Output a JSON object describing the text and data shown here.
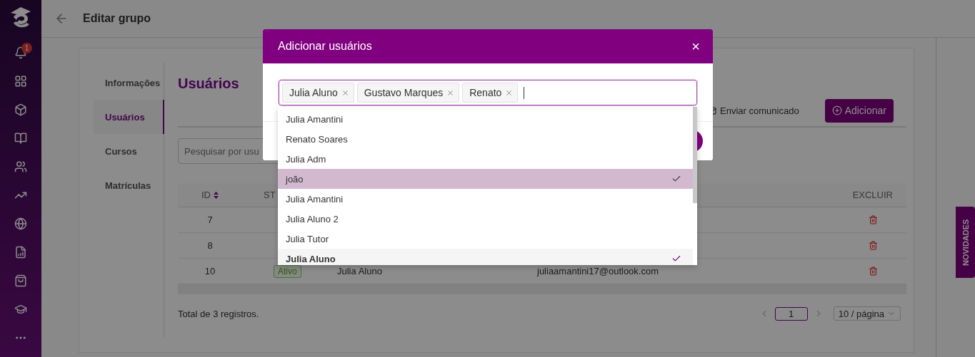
{
  "sidebar": {
    "notifications": "1",
    "items": [
      {
        "kind": "grid"
      },
      {
        "kind": "box"
      },
      {
        "kind": "book"
      },
      {
        "kind": "users"
      },
      {
        "kind": "trend"
      },
      {
        "kind": "globe"
      },
      {
        "kind": "report"
      },
      {
        "kind": "bag"
      },
      {
        "kind": "cap"
      },
      {
        "kind": "more"
      }
    ]
  },
  "header": {
    "title": "Editar grupo"
  },
  "tabs": [
    {
      "label": "Informações",
      "selected": false
    },
    {
      "label": "Usuários",
      "selected": true
    },
    {
      "label": "Cursos",
      "selected": false
    },
    {
      "label": "Matrículas",
      "selected": false
    }
  ],
  "content": {
    "title": "Usuários",
    "actions": {
      "message": "Enviar comunicado",
      "add": "Adicionar"
    },
    "search": {
      "placeholder": "Pesquisar por usu"
    }
  },
  "table": {
    "columns": [
      {
        "label": "ID",
        "sortable": true
      },
      {
        "label": "ST",
        "sortable": false
      },
      {
        "label": "EXCLUIR",
        "sortable": false
      }
    ],
    "rows": [
      {
        "id": "7"
      },
      {
        "id": "8"
      },
      {
        "id": "10",
        "status": "Ativo",
        "name": "Julia Aluno",
        "email": "juliaamantini17@outlook.com"
      }
    ]
  },
  "footer": {
    "total": "Total de 3 registros.",
    "page": "1",
    "page_size": "10 / página"
  },
  "news_tab": "NOVIDADES",
  "modal": {
    "title": "Adicionar usuários",
    "close": "×",
    "tags": [
      "Julia Aluno",
      "Gustavo Marques",
      "Renato"
    ],
    "options": [
      {
        "label": "Julia Amantini",
        "selected": false,
        "active": false
      },
      {
        "label": "Renato Soares",
        "selected": false,
        "active": false
      },
      {
        "label": "Julia Adm",
        "selected": false,
        "active": false
      },
      {
        "label": "joão",
        "selected": true,
        "active": true
      },
      {
        "label": "Julia Amantini",
        "selected": false,
        "active": false
      },
      {
        "label": "Julia Aluno 2",
        "selected": false,
        "active": false
      },
      {
        "label": "Julia Tutor",
        "selected": false,
        "active": false
      },
      {
        "label": "Julia Aluno",
        "selected": true,
        "active": false
      }
    ]
  }
}
